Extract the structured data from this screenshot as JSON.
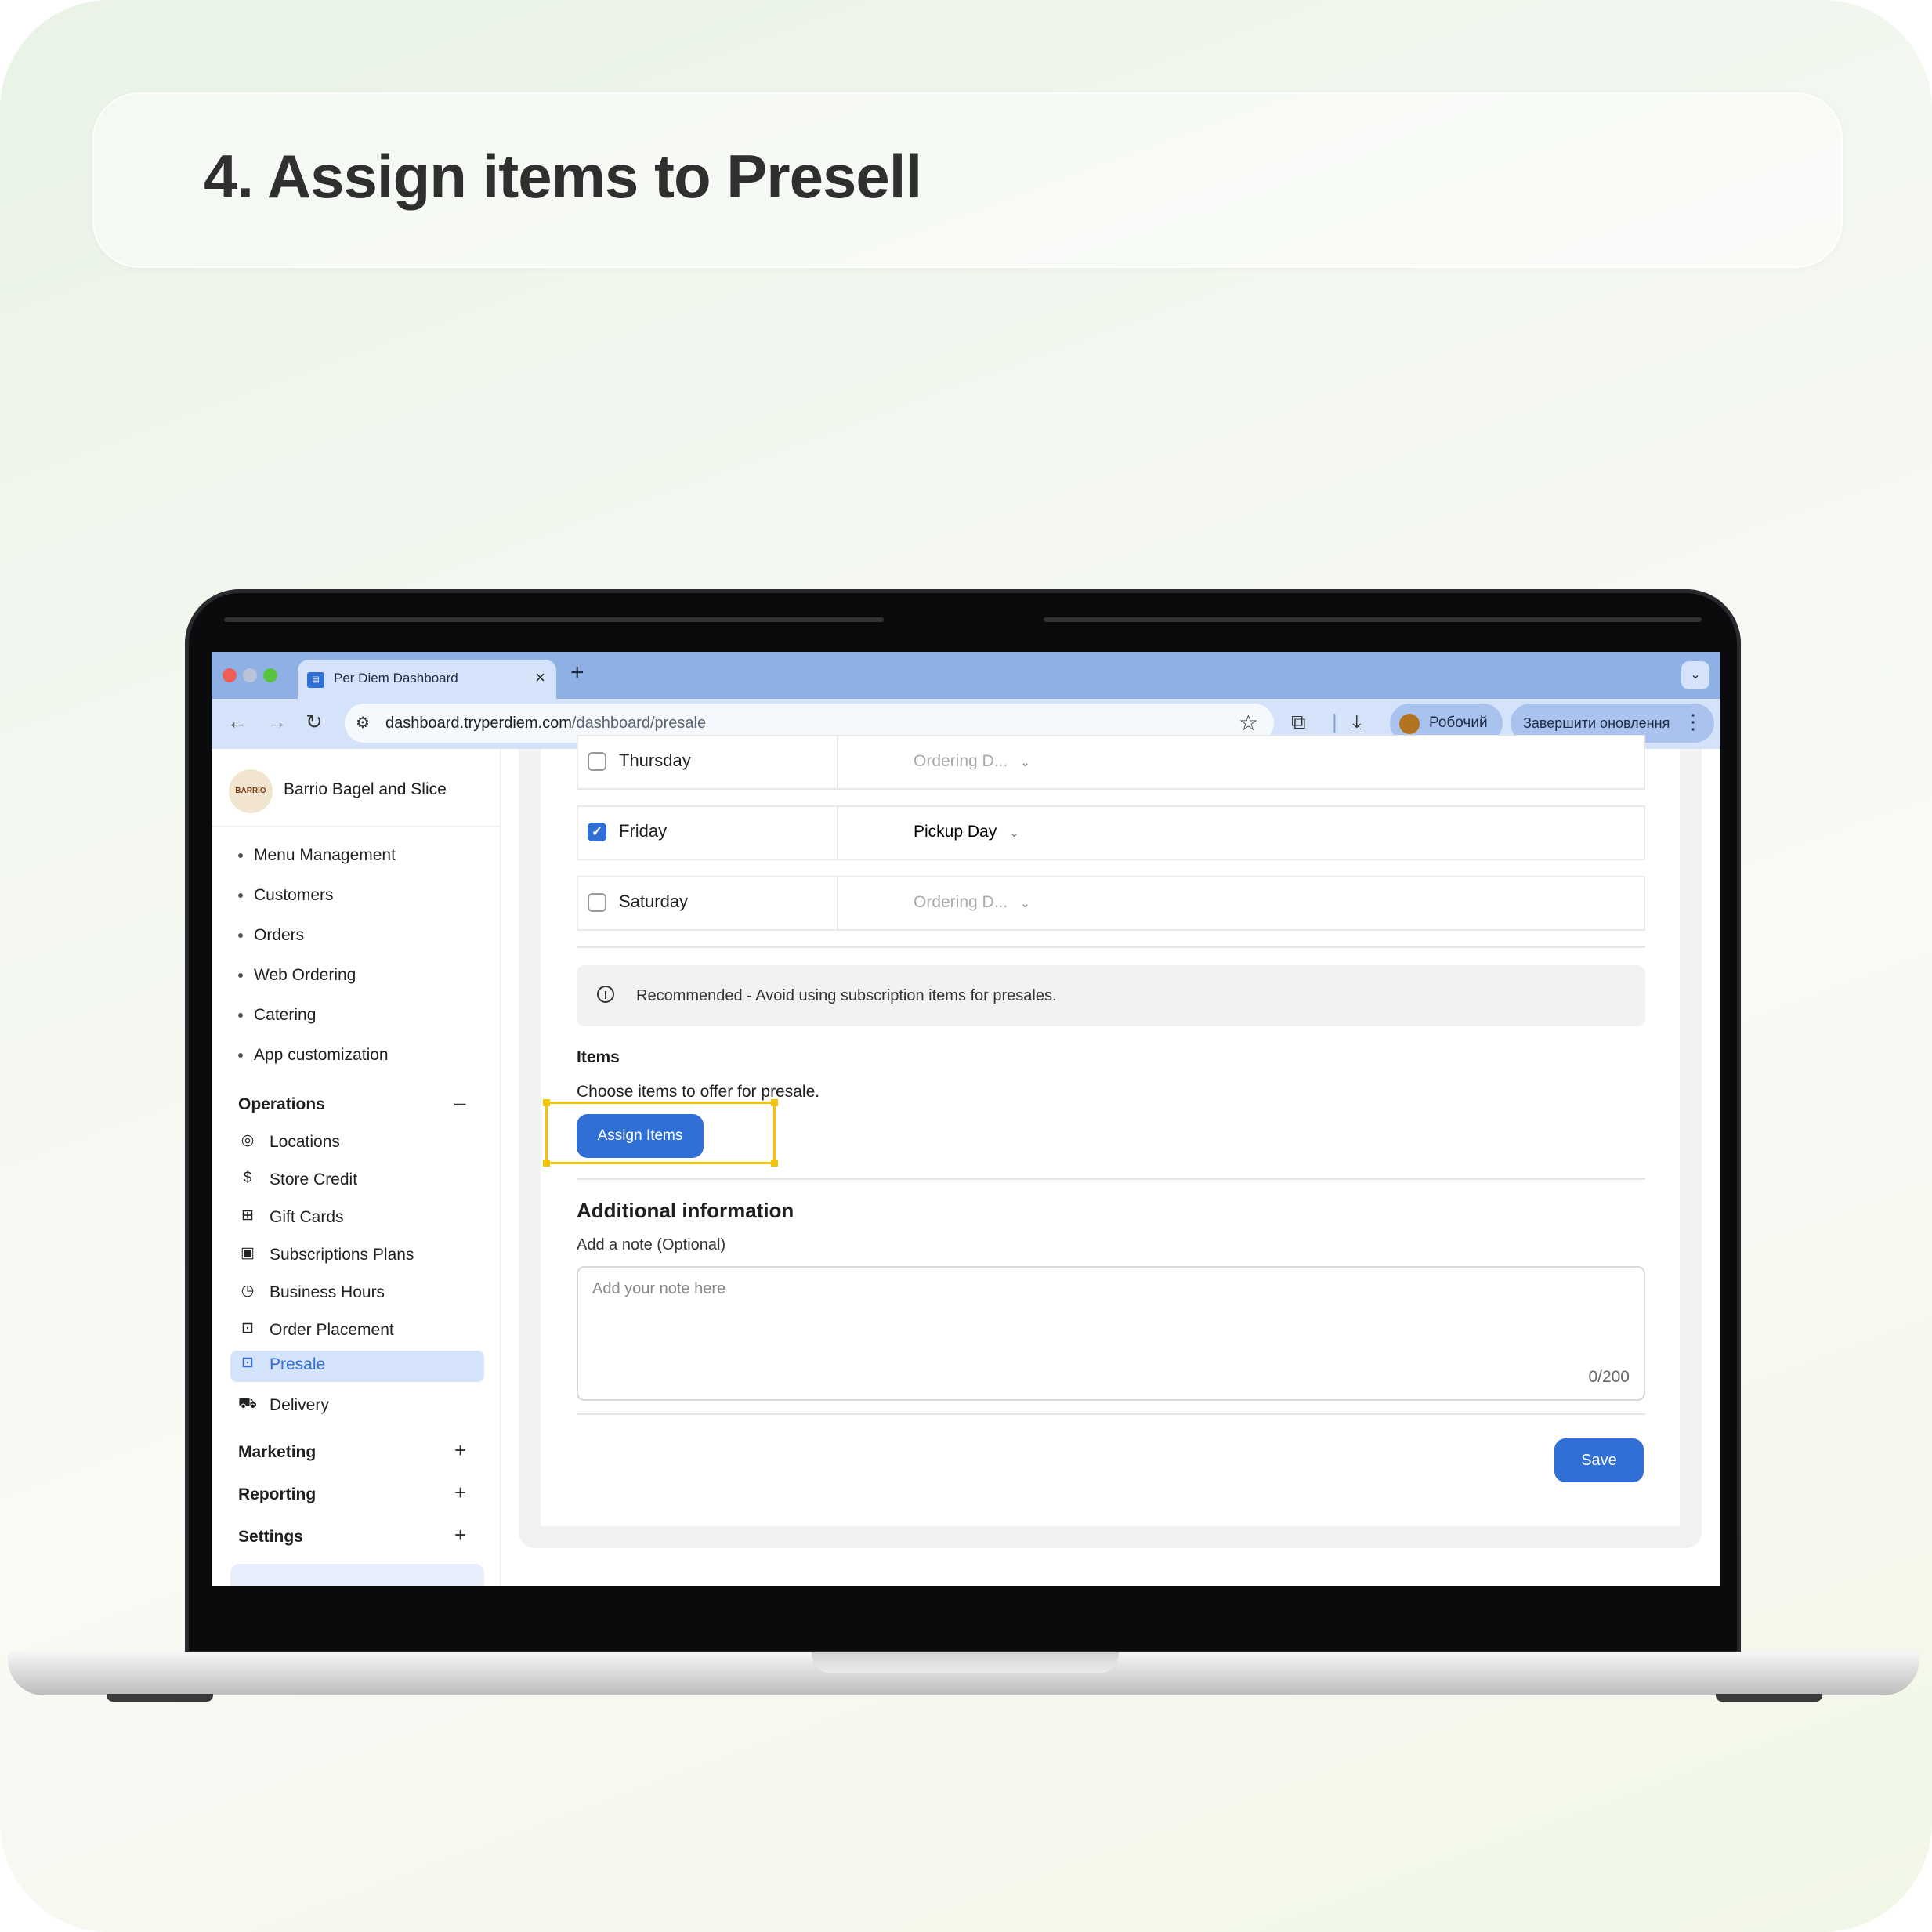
{
  "header": {
    "title": "4. Assign items to Presell"
  },
  "browser": {
    "tab_title": "Per Diem Dashboard",
    "tab_close": "×",
    "new_tab": "+",
    "url_host": "dashboard.tryperdiem.com",
    "url_path": "/dashboard/presale",
    "profile_label": "Робочий",
    "update_label": "Завершити оновлення"
  },
  "sidebar": {
    "brand_name": "Barrio Bagel and Slice",
    "brand_logo_text": "BARRIO",
    "menu_items": [
      "Menu Management",
      "Customers",
      "Orders",
      "Web Ordering",
      "Catering",
      "App customization"
    ],
    "operations": {
      "title": "Operations",
      "toggle": "–",
      "items": [
        {
          "label": "Locations",
          "icon": "location-pin-icon"
        },
        {
          "label": "Store Credit",
          "icon": "store-credit-icon"
        },
        {
          "label": "Gift Cards",
          "icon": "gift-icon"
        },
        {
          "label": "Subscriptions Plans",
          "icon": "subscription-icon"
        },
        {
          "label": "Business Hours",
          "icon": "clock-icon"
        },
        {
          "label": "Order Placement",
          "icon": "order-bag-icon"
        },
        {
          "label": "Presale",
          "icon": "presale-bag-icon",
          "active": true
        },
        {
          "label": "Delivery",
          "icon": "delivery-truck-icon"
        }
      ]
    },
    "marketing": {
      "title": "Marketing",
      "toggle": "+"
    },
    "reporting": {
      "title": "Reporting",
      "toggle": "+"
    },
    "settings": {
      "title": "Settings",
      "toggle": "+"
    }
  },
  "presale": {
    "days": [
      {
        "day": "Thursday",
        "checked": false,
        "mode": "Ordering D..."
      },
      {
        "day": "Friday",
        "checked": true,
        "mode": "Pickup Day"
      },
      {
        "day": "Saturday",
        "checked": false,
        "mode": "Ordering D..."
      }
    ],
    "notice": "Recommended - Avoid using subscription items for presales.",
    "items_title": "Items",
    "items_desc": "Choose items to offer for presale.",
    "assign_label": "Assign Items",
    "additional_title": "Additional information",
    "note_label": "Add a note (Optional)",
    "note_placeholder": "Add your note here",
    "note_count": "0/200",
    "save_label": "Save"
  },
  "colors": {
    "accent": "#2f6fd6",
    "highlight": "#f4c400",
    "browser_frame": "#8fb0e5"
  }
}
